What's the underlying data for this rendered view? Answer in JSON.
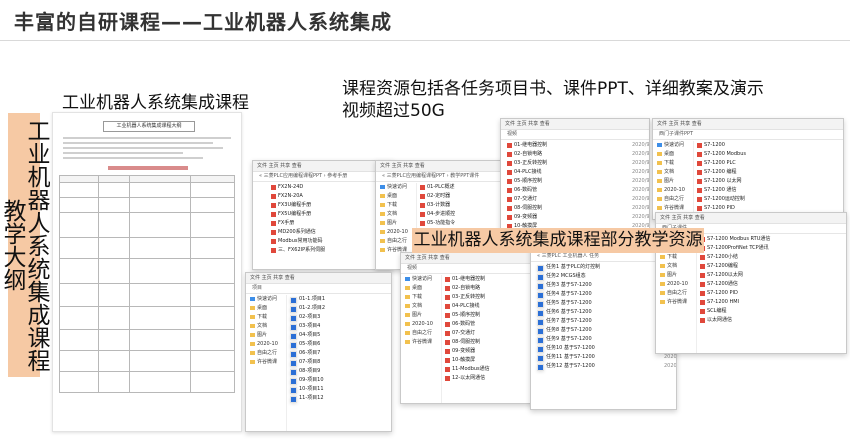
{
  "slide": {
    "title": "丰富的自研课程——工业机器人系统集成",
    "left_heading": "工业机器人系统集成课程",
    "right_heading": "课程资源包括各任务项目书、课件PPT、详细教案及演示视频超过50G",
    "vertical_label": "工业机器人系统集成课程教学大纲",
    "banner": "工业机器人系统集成课程部分教学资源"
  },
  "document": {
    "title": "工业机器人系统集成课程大纲"
  },
  "colors": {
    "accent_fill": "#f6c9a4",
    "folder": "#f2c14e",
    "pdf": "#e0483b",
    "doc": "#2b6fd6"
  },
  "nav_common": [
    "快速访问",
    "桌面",
    "下载",
    "文档",
    "图片",
    "2020-10",
    "自由之行",
    "许谷微课"
  ],
  "win_a": {
    "addr": "« 三菱PLC应用编程课程PPT › 参考手册",
    "files": [
      "FX2N-24D",
      "FX2N-20A",
      "FX3U编程手册",
      "FX5U编程手册",
      "FX手册",
      "MD200系列通信",
      "Modbus常用功能码",
      "三、FX62IP系列伺服"
    ]
  },
  "win_b": {
    "addr": "« 三菱PLC应用编程课程PPT › 教学PPT课件",
    "files": [
      "01-PLC概述",
      "02-定时器",
      "03-计数器",
      "04-步进顺控",
      "05-功能指令",
      "06-运动控制",
      "07-通信"
    ]
  },
  "win_c": {
    "addr": "视频",
    "files": [
      "01-继电器控制",
      "02-自锁电路",
      "03-正反转控制",
      "04-PLC接线",
      "05-顺序控制",
      "06-数码管",
      "07-交通灯",
      "08-伺服控制",
      "09-变频器",
      "10-触摸屏",
      "11-Modbus通信",
      "12-以太网通信"
    ]
  },
  "win_d": {
    "addr": "« 三菱PLC 工业机器人 任务",
    "files": [
      "任务1 基于PLC的灯控制",
      "任务2 MCGS组态",
      "任务3 基于S7-1200",
      "任务4 基于S7-1200",
      "任务5 基于S7-1200",
      "任务6 基于S7-1200",
      "任务7 基于S7-1200",
      "任务8 基于S7-1200",
      "任务9 基于S7-1200",
      "任务10 基于S7-1200",
      "任务11 基于S7-1200",
      "任务12 基于S7-1200"
    ]
  },
  "win_e": {
    "addr": "项目",
    "files": [
      "01-1.项目1",
      "01-2.项目2",
      "02-项目3",
      "03-项目4",
      "04-项目5",
      "05-项目6",
      "06-项目7",
      "07-项目8",
      "08-项目9",
      "09-项目10",
      "10-项目11",
      "11-项目12"
    ]
  },
  "win_f": {
    "addr": "西门子课件PPT",
    "files": [
      "S7-1200",
      "S7-1200 Modbus",
      "S7-1200 PLC",
      "S7-1200 编程",
      "S7-1200 以太网",
      "S7-1200 通信",
      "S7-1200运动控制",
      "S7-1200 PID",
      "S7-1200 HMI",
      "S7-1200 高速计数",
      "S7-1200 工艺",
      "S7-1200 故障"
    ]
  },
  "win_g": {
    "addr": "西门子课件",
    "files": [
      "S7-1200 Modbus RTU通信",
      "S7-1200ProfiNet TCP通讯",
      "S7-1200小结",
      "S7-1200编程",
      "S7-1200以太网",
      "S7-1200通信",
      "S7-1200 PID",
      "S7-1200 HMI",
      "SCL编程",
      "以太网通信"
    ]
  },
  "dates": [
    "2020/9/21",
    "2020/9/22",
    "2020/9/23",
    "2020/9/24",
    "2020/9/25",
    "2020/9/26",
    "2020/9/27",
    "2020/9/28",
    "2020/9/29",
    "2020/9/30",
    "2020/10/1",
    "2020/10/2"
  ]
}
